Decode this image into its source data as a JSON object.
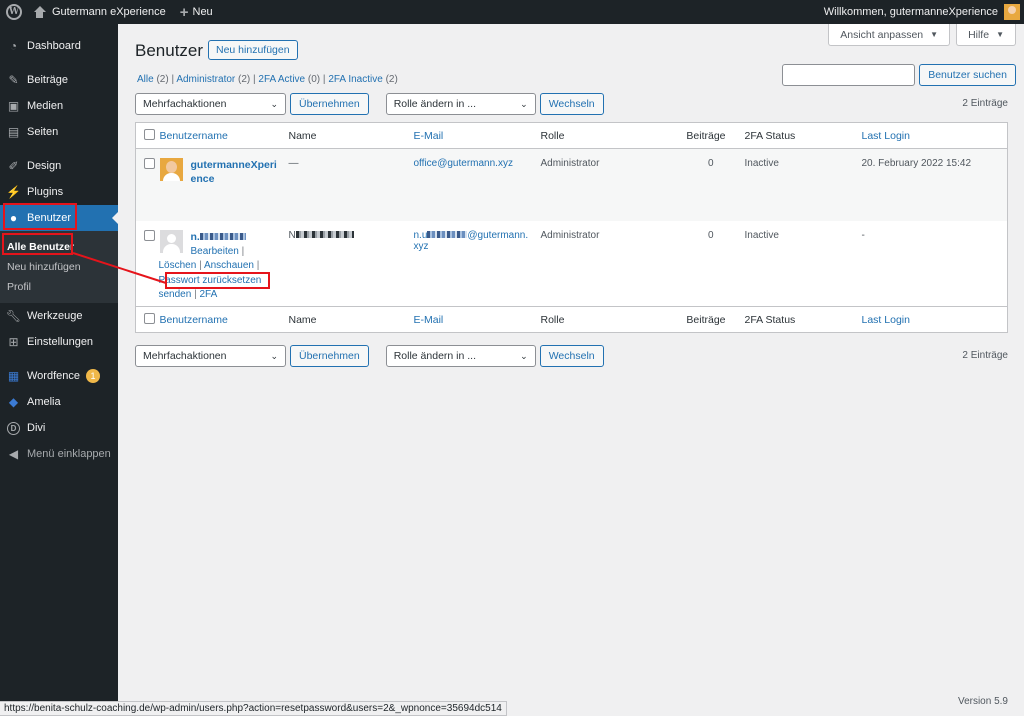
{
  "adminbar": {
    "site_name": "Gutermann eXperience",
    "new_label": "Neu",
    "greeting": "Willkommen, gutermanneXperience"
  },
  "sidebar": {
    "items": [
      {
        "label": "Dashboard",
        "icon": "dashboard-icon"
      },
      {
        "label": "Beiträge",
        "icon": "pin-icon"
      },
      {
        "label": "Medien",
        "icon": "media-icon"
      },
      {
        "label": "Seiten",
        "icon": "pages-icon"
      },
      {
        "label": "Design",
        "icon": "brush-icon"
      },
      {
        "label": "Plugins",
        "icon": "plugin-icon"
      },
      {
        "label": "Benutzer",
        "icon": "user-icon"
      },
      {
        "label": "Werkzeuge",
        "icon": "wrench-icon"
      },
      {
        "label": "Einstellungen",
        "icon": "settings-icon"
      },
      {
        "label": "Wordfence",
        "icon": "wordfence-icon",
        "badge": "1"
      },
      {
        "label": "Amelia",
        "icon": "amelia-icon"
      },
      {
        "label": "Divi",
        "icon": "divi-icon"
      },
      {
        "label": "Menü einklappen",
        "icon": "collapse-icon"
      }
    ],
    "submenu": [
      "Alle Benutzer",
      "Neu hinzufügen",
      "Profil"
    ]
  },
  "screen": {
    "options": "Ansicht anpassen",
    "help": "Hilfe"
  },
  "page": {
    "title": "Benutzer",
    "add_new": "Neu hinzufügen"
  },
  "filters": {
    "all": "Alle",
    "all_count": "(2)",
    "admin": "Administrator",
    "admin_count": "(2)",
    "active": "2FA Active",
    "active_count": "(0)",
    "inactive": "2FA Inactive",
    "inactive_count": "(2)",
    "sep": "|"
  },
  "search": {
    "button": "Benutzer suchen"
  },
  "tablenav": {
    "bulk": "Mehrfachaktionen",
    "apply": "Übernehmen",
    "role": "Rolle ändern in ...",
    "change": "Wechseln",
    "count": "2 Einträge"
  },
  "table": {
    "headers": [
      "Benutzername",
      "Name",
      "E-Mail",
      "Rolle",
      "Beiträge",
      "2FA Status",
      "Last Login"
    ],
    "rows": [
      {
        "username_line1": "gutermanneXperi",
        "username_line2": "ence",
        "name": "—",
        "email": "office@gutermann.xyz",
        "role": "Administrator",
        "posts": "0",
        "status": "Inactive",
        "last_login": "20. February 2022 15:42"
      },
      {
        "username_prefix": "n.",
        "name_prefix": "N",
        "email_prefix": "n.u",
        "email_suffix": "@gutermann.",
        "email_line2": "xyz",
        "role": "Administrator",
        "posts": "0",
        "status": "Inactive",
        "last_login": "-",
        "actions": {
          "edit": "Bearbeiten",
          "delete": "Löschen",
          "view": "Anschauen",
          "reset": "Passwort zurücksetzen",
          "send": "senden",
          "twofa": "2FA",
          "sep": "|"
        }
      }
    ]
  },
  "footer": {
    "version": "Version 5.9"
  },
  "statusbar": {
    "url": "https://benita-schulz-coaching.de/wp-admin/users.php?action=resetpassword&users=2&_wpnonce=35694dc514"
  },
  "colors": {
    "accent": "#2271b1",
    "sidebar": "#1d2327",
    "annotation": "#e5141b"
  }
}
